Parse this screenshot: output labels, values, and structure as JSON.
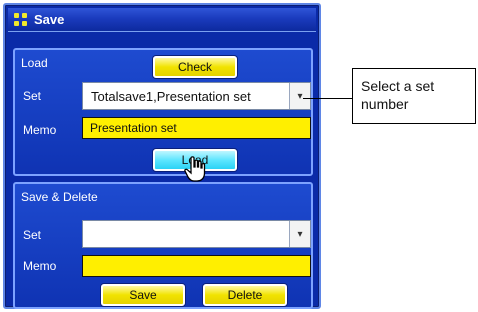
{
  "window": {
    "title": "Save",
    "icon": "menu-grid-icon"
  },
  "load_section": {
    "title": "Load",
    "check_button": "Check",
    "set_label": "Set",
    "set_value": "Totalsave1,Presentation set",
    "memo_label": "Memo",
    "memo_value": "Presentation set",
    "load_button": "Load"
  },
  "save_section": {
    "title": "Save & Delete",
    "set_label": "Set",
    "set_value": "",
    "memo_label": "Memo",
    "memo_value": "",
    "save_button": "Save",
    "delete_button": "Delete"
  },
  "callout": {
    "text": "Select a set number"
  },
  "colors": {
    "panel_bg": "#0a2aa8",
    "accent_yellow": "#ffef00",
    "accent_cyan": "#5fe6ff",
    "title_icon_yellow": "#f2ea2b"
  },
  "icons": {
    "dropdown": "chevron-down-icon",
    "cursor": "hand-pointer-icon"
  }
}
